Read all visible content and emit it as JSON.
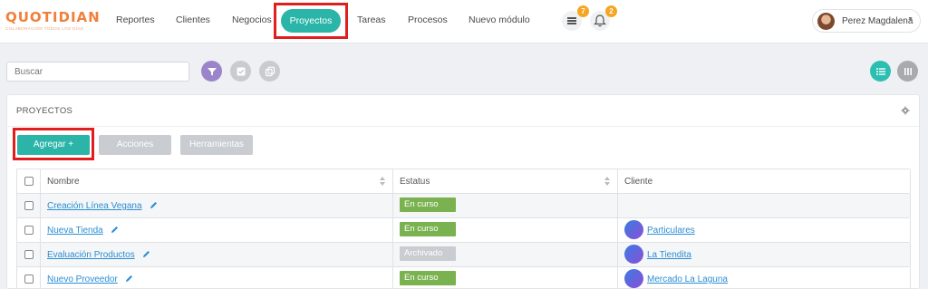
{
  "brand": {
    "logo_text": "QUOTIDIAN",
    "tagline": "COLABORACIÓN TODOS LOS DÍAS"
  },
  "nav": {
    "items": [
      "Reportes",
      "Clientes",
      "Negocios",
      "Proyectos",
      "Tareas",
      "Procesos",
      "Nuevo módulo"
    ],
    "active": "Proyectos"
  },
  "notifications": {
    "messages_count": "7",
    "alerts_count": "2",
    "messages_icon": "inbox-icon",
    "alerts_icon": "bell-icon"
  },
  "user": {
    "name": "Perez Magdalena"
  },
  "search": {
    "placeholder": "Buscar"
  },
  "toolbar_icons": [
    "filter-icon",
    "checkbox-icon",
    "copy-icon"
  ],
  "view_icons": [
    "list-view-icon",
    "column-view-icon"
  ],
  "panel": {
    "title": "PROYECTOS",
    "buttons": {
      "add": "Agregar +",
      "actions": "Acciones",
      "tools": "Herramientas"
    }
  },
  "table": {
    "columns": [
      "Nombre",
      "Estatus",
      "Cliente"
    ],
    "rows": [
      {
        "name": "Creación Línea Vegana",
        "status": "En curso",
        "client": ""
      },
      {
        "name": "Nueva Tienda",
        "status": "En curso",
        "client": "Particulares"
      },
      {
        "name": "Evaluación Productos",
        "status": "Archivado",
        "client": "La Tiendita"
      },
      {
        "name": "Nuevo Proveedor",
        "status": "En curso",
        "client": "Mercado La Laguna"
      }
    ]
  },
  "colors": {
    "accent": "#2bb5a8",
    "status_active": "#7ab24f",
    "status_archived": "#c9ccd1",
    "highlight": "#e01e1e",
    "badge": "#f5a623"
  }
}
